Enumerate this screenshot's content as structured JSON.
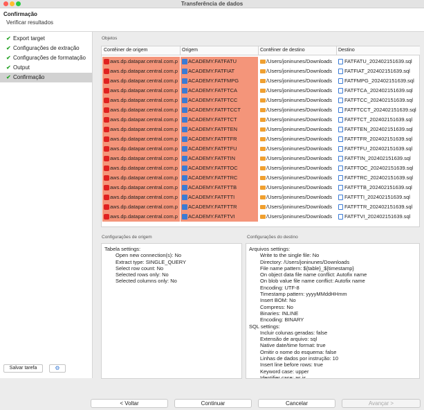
{
  "window": {
    "title": "Transferência de dados"
  },
  "header": {
    "title": "Confirmação",
    "subtitle": "Verificar resultados"
  },
  "sidebar": {
    "steps": [
      {
        "label": "Export target",
        "active": false
      },
      {
        "label": "Configurações de extração",
        "active": false
      },
      {
        "label": "Configurações de formatação",
        "active": false
      },
      {
        "label": "Output",
        "active": false
      },
      {
        "label": "Confirmação",
        "active": true
      }
    ],
    "save_task_label": "Salvar tarefa",
    "settings_icon": "gear-icon"
  },
  "objects": {
    "title": "Objetos",
    "columns": [
      "Contêiner de origem",
      "Origem",
      "Contêiner de destino",
      "Destino"
    ],
    "rows": [
      [
        "aws.dp.datapar.central.com.p",
        "ACADEMY.FATFATU",
        "/Users/joninunes/Downloads",
        "FATFATU_202402151639.sql"
      ],
      [
        "aws.dp.datapar.central.com.p",
        "ACADEMY.FATFIAT",
        "/Users/joninunes/Downloads",
        "FATFIAT_202402151639.sql"
      ],
      [
        "aws.dp.datapar.central.com.p",
        "ACADEMY.FATFMPG",
        "/Users/joninunes/Downloads",
        "FATFMPG_202402151639.sql"
      ],
      [
        "aws.dp.datapar.central.com.p",
        "ACADEMY.FATFTCA",
        "/Users/joninunes/Downloads",
        "FATFTCA_202402151639.sql"
      ],
      [
        "aws.dp.datapar.central.com.p",
        "ACADEMY.FATFTCC",
        "/Users/joninunes/Downloads",
        "FATFTCC_202402151639.sql"
      ],
      [
        "aws.dp.datapar.central.com.p",
        "ACADEMY.FATFTCCT",
        "/Users/joninunes/Downloads",
        "FATFTCCT_202402151639.sql"
      ],
      [
        "aws.dp.datapar.central.com.p",
        "ACADEMY.FATFTCT",
        "/Users/joninunes/Downloads",
        "FATFTCT_202402151639.sql"
      ],
      [
        "aws.dp.datapar.central.com.p",
        "ACADEMY.FATFTEN",
        "/Users/joninunes/Downloads",
        "FATFTEN_202402151639.sql"
      ],
      [
        "aws.dp.datapar.central.com.p",
        "ACADEMY.FATFTFR",
        "/Users/joninunes/Downloads",
        "FATFTFR_202402151639.sql"
      ],
      [
        "aws.dp.datapar.central.com.p",
        "ACADEMY.FATFTFU",
        "/Users/joninunes/Downloads",
        "FATFTFU_202402151639.sql"
      ],
      [
        "aws.dp.datapar.central.com.p",
        "ACADEMY.FATFTIN",
        "/Users/joninunes/Downloads",
        "FATFTIN_202402151639.sql"
      ],
      [
        "aws.dp.datapar.central.com.p",
        "ACADEMY.FATFTOC",
        "/Users/joninunes/Downloads",
        "FATFTOC_202402151639.sql"
      ],
      [
        "aws.dp.datapar.central.com.p",
        "ACADEMY.FATFTRC",
        "/Users/joninunes/Downloads",
        "FATFTRC_202402151639.sql"
      ],
      [
        "aws.dp.datapar.central.com.p",
        "ACADEMY.FATFTTB",
        "/Users/joninunes/Downloads",
        "FATFTTB_202402151639.sql"
      ],
      [
        "aws.dp.datapar.central.com.p",
        "ACADEMY.FATFTTI",
        "/Users/joninunes/Downloads",
        "FATFTTI_202402151639.sql"
      ],
      [
        "aws.dp.datapar.central.com.p",
        "ACADEMY.FATFTTR",
        "/Users/joninunes/Downloads",
        "FATFTTR_202402151639.sql"
      ],
      [
        "aws.dp.datapar.central.com.p",
        "ACADEMY.FATFTVI",
        "/Users/joninunes/Downloads",
        "FATFTVI_202402151639.sql"
      ]
    ]
  },
  "source_config": {
    "title": "Configurações de origem",
    "lines": [
      {
        "text": "Tabela settings:",
        "indent": false
      },
      {
        "text": "Open new connection(s): No",
        "indent": true
      },
      {
        "text": "Extract type: SINGLE_QUERY",
        "indent": true
      },
      {
        "text": "Select row count: No",
        "indent": true
      },
      {
        "text": "Selected rows only: No",
        "indent": true
      },
      {
        "text": "Selected columns only: No",
        "indent": true
      }
    ]
  },
  "dest_config": {
    "title": "Configurações do destino",
    "lines": [
      {
        "text": "Arquivos settings:",
        "indent": false
      },
      {
        "text": "Write to the single file: No",
        "indent": true
      },
      {
        "text": "Directory: /Users/joninunes/Downloads",
        "indent": true
      },
      {
        "text": "File name pattern: ${table}_${timestamp}",
        "indent": true
      },
      {
        "text": "On object data file name conflict: Autofix name",
        "indent": true
      },
      {
        "text": "On blob value file name conflict: Autofix name",
        "indent": true
      },
      {
        "text": "Encoding: UTF-8",
        "indent": true
      },
      {
        "text": "Timestamp pattern: yyyyMMddHHmm",
        "indent": true
      },
      {
        "text": "Insert BOM: No",
        "indent": true
      },
      {
        "text": "Compress: No",
        "indent": true
      },
      {
        "text": "Binaries: INLINE",
        "indent": true
      },
      {
        "text": "Encoding: BINARY",
        "indent": true
      },
      {
        "text": "SQL settings:",
        "indent": false
      },
      {
        "text": "Incluir colunas geradas: false",
        "indent": true
      },
      {
        "text": "Extensão de arquivo: sql",
        "indent": true
      },
      {
        "text": "Native date/time format: true",
        "indent": true
      },
      {
        "text": "Omitir o nome do esquema: false",
        "indent": true
      },
      {
        "text": "Linhas de dados por instrução: 10",
        "indent": true
      },
      {
        "text": "Insert line before rows: true",
        "indent": true
      },
      {
        "text": "Keyword case: upper",
        "indent": true
      },
      {
        "text": "Identifier case: as is",
        "indent": true
      }
    ]
  },
  "footer": {
    "back_label": "< Voltar",
    "continue_label": "Continuar",
    "cancel_label": "Cancelar",
    "next_label": "Avançar >"
  },
  "colors": {
    "highlight": "#f4957a",
    "check": "#2ba52b"
  }
}
